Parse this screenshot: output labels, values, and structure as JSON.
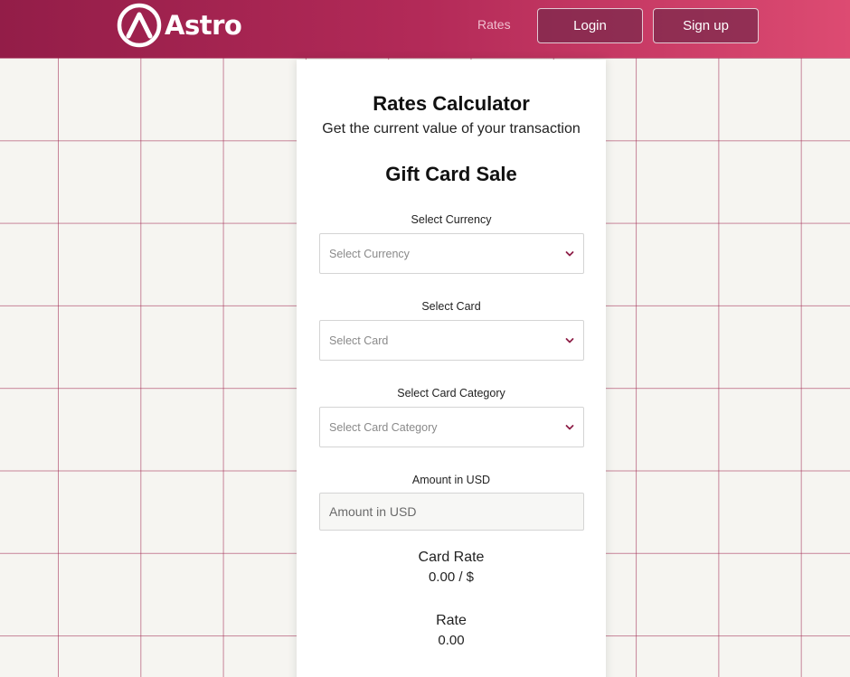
{
  "brand": {
    "name": "Astro",
    "colors": {
      "primary": "#931d48",
      "accent": "#dd4b72"
    }
  },
  "nav": {
    "rates_label": "Rates",
    "login_label": "Login",
    "signup_label": "Sign up"
  },
  "calculator": {
    "title": "Rates Calculator",
    "subtitle": "Get the current value of your transaction",
    "section": "Gift Card Sale",
    "fields": [
      {
        "label": "Select Currency",
        "placeholder": "Select Currency",
        "icon": "chevron-down-icon"
      },
      {
        "label": "Select Card",
        "placeholder": "Select Card",
        "icon": "chevron-down-icon"
      },
      {
        "label": "Select Card Category",
        "placeholder": "Select Card Category",
        "icon": "chevron-down-icon"
      }
    ],
    "amount": {
      "label": "Amount in USD",
      "placeholder": "Amount in USD"
    },
    "card_rate": {
      "label": "Card Rate",
      "value": "0.00 / $"
    },
    "rate": {
      "label": "Rate",
      "value": "0.00"
    }
  }
}
